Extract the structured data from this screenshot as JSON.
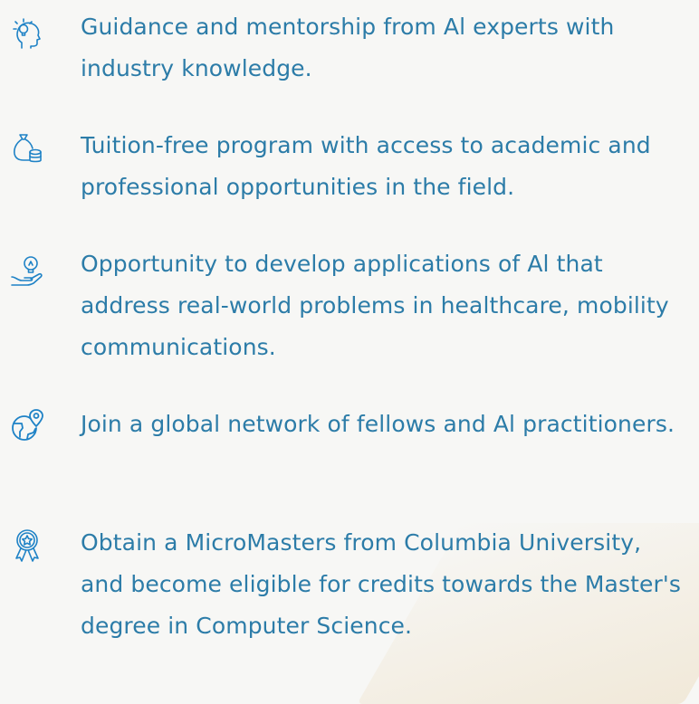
{
  "benefits": [
    {
      "icon": "mentor-lightbulb-head-icon",
      "text": "Guidance and mentorship from Al experts with industry knowledge."
    },
    {
      "icon": "money-bag-coins-icon",
      "text": "Tuition-free program with access to academic and professional opportunities in the field."
    },
    {
      "icon": "hand-lightbulb-icon",
      "text": "Opportunity to develop applications of Al that address real-world problems in healthcare, mobility communications."
    },
    {
      "icon": "globe-location-pin-icon",
      "text": "Join a global network of fellows and Al practitioners."
    },
    {
      "icon": "award-ribbon-icon",
      "text": "Obtain a MicroMasters from Columbia University, and become eligible for credits towards the Master's degree in Computer Science."
    }
  ],
  "colors": {
    "text": "#2c7ca8",
    "icon": "#1e82c6",
    "background": "#f7f7f5"
  }
}
